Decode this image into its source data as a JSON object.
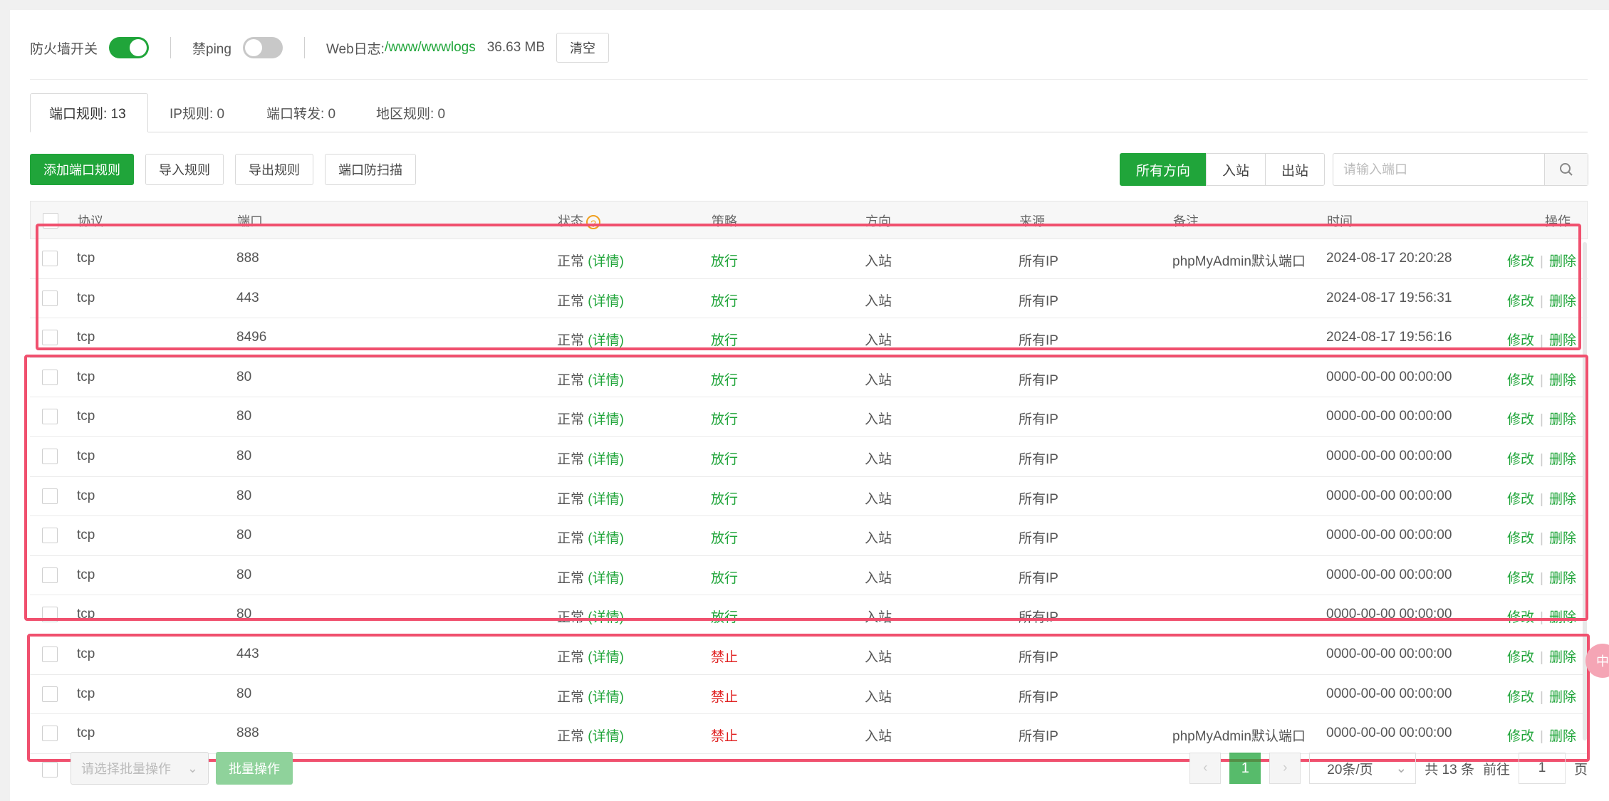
{
  "topbar": {
    "firewall_label": "防火墙开关",
    "firewall_on": true,
    "ping_label": "禁ping",
    "ping_on": false,
    "weblog_label": "Web日志:",
    "weblog_path": "/www/wwwlogs",
    "weblog_size": "36.63 MB",
    "clear_label": "清空"
  },
  "tabs": [
    {
      "label": "端口规则: 13",
      "active": true
    },
    {
      "label": "IP规则: 0",
      "active": false
    },
    {
      "label": "端口转发: 0",
      "active": false
    },
    {
      "label": "地区规则: 0",
      "active": false
    }
  ],
  "toolbar": {
    "add": "添加端口规则",
    "import": "导入规则",
    "export": "导出规则",
    "scan": "端口防扫描",
    "dir_all": "所有方向",
    "dir_in": "入站",
    "dir_out": "出站",
    "search_placeholder": "请输入端口"
  },
  "columns": [
    "协议",
    "端口",
    "状态",
    "策略",
    "方向",
    "来源",
    "备注",
    "时间",
    "操作"
  ],
  "rows": [
    {
      "protocol": "tcp",
      "port": "888",
      "status": "正常",
      "detail": "(详情)",
      "policy": "放行",
      "direction": "入站",
      "source": "所有IP",
      "note": "phpMyAdmin默认端口",
      "time": "2024-08-17 20:20:28",
      "edit": "修改",
      "delete": "删除"
    },
    {
      "protocol": "tcp",
      "port": "443",
      "status": "正常",
      "detail": "(详情)",
      "policy": "放行",
      "direction": "入站",
      "source": "所有IP",
      "note": "",
      "time": "2024-08-17 19:56:31",
      "edit": "修改",
      "delete": "删除"
    },
    {
      "protocol": "tcp",
      "port": "8496",
      "status": "正常",
      "detail": "(详情)",
      "policy": "放行",
      "direction": "入站",
      "source": "所有IP",
      "note": "",
      "time": "2024-08-17 19:56:16",
      "edit": "修改",
      "delete": "删除"
    },
    {
      "protocol": "tcp",
      "port": "80",
      "status": "正常",
      "detail": "(详情)",
      "policy": "放行",
      "direction": "入站",
      "source": "所有IP",
      "note": "",
      "time": "0000-00-00 00:00:00",
      "edit": "修改",
      "delete": "删除"
    },
    {
      "protocol": "tcp",
      "port": "80",
      "status": "正常",
      "detail": "(详情)",
      "policy": "放行",
      "direction": "入站",
      "source": "所有IP",
      "note": "",
      "time": "0000-00-00 00:00:00",
      "edit": "修改",
      "delete": "删除"
    },
    {
      "protocol": "tcp",
      "port": "80",
      "status": "正常",
      "detail": "(详情)",
      "policy": "放行",
      "direction": "入站",
      "source": "所有IP",
      "note": "",
      "time": "0000-00-00 00:00:00",
      "edit": "修改",
      "delete": "删除"
    },
    {
      "protocol": "tcp",
      "port": "80",
      "status": "正常",
      "detail": "(详情)",
      "policy": "放行",
      "direction": "入站",
      "source": "所有IP",
      "note": "",
      "time": "0000-00-00 00:00:00",
      "edit": "修改",
      "delete": "删除"
    },
    {
      "protocol": "tcp",
      "port": "80",
      "status": "正常",
      "detail": "(详情)",
      "policy": "放行",
      "direction": "入站",
      "source": "所有IP",
      "note": "",
      "time": "0000-00-00 00:00:00",
      "edit": "修改",
      "delete": "删除"
    },
    {
      "protocol": "tcp",
      "port": "80",
      "status": "正常",
      "detail": "(详情)",
      "policy": "放行",
      "direction": "入站",
      "source": "所有IP",
      "note": "",
      "time": "0000-00-00 00:00:00",
      "edit": "修改",
      "delete": "删除"
    },
    {
      "protocol": "tcp",
      "port": "80",
      "status": "正常",
      "detail": "(详情)",
      "policy": "放行",
      "direction": "入站",
      "source": "所有IP",
      "note": "",
      "time": "0000-00-00 00:00:00",
      "edit": "修改",
      "delete": "删除"
    },
    {
      "protocol": "tcp",
      "port": "443",
      "status": "正常",
      "detail": "(详情)",
      "policy": "禁止",
      "direction": "入站",
      "source": "所有IP",
      "note": "",
      "time": "0000-00-00 00:00:00",
      "edit": "修改",
      "delete": "删除"
    },
    {
      "protocol": "tcp",
      "port": "80",
      "status": "正常",
      "detail": "(详情)",
      "policy": "禁止",
      "direction": "入站",
      "source": "所有IP",
      "note": "",
      "time": "0000-00-00 00:00:00",
      "edit": "修改",
      "delete": "删除"
    },
    {
      "protocol": "tcp",
      "port": "888",
      "status": "正常",
      "detail": "(详情)",
      "policy": "禁止",
      "direction": "入站",
      "source": "所有IP",
      "note": "phpMyAdmin默认端口",
      "time": "0000-00-00 00:00:00",
      "edit": "修改",
      "delete": "删除"
    }
  ],
  "footer": {
    "batch_placeholder": "请选择批量操作",
    "batch_button": "批量操作",
    "current_page": "1",
    "page_size": "20条/页",
    "total": "共 13 条",
    "goto_prefix": "前往",
    "goto_value": "1",
    "goto_suffix": "页"
  },
  "colors": {
    "accent": "#20a53a",
    "deny": "#e02020",
    "highlight": "#f0506e"
  }
}
